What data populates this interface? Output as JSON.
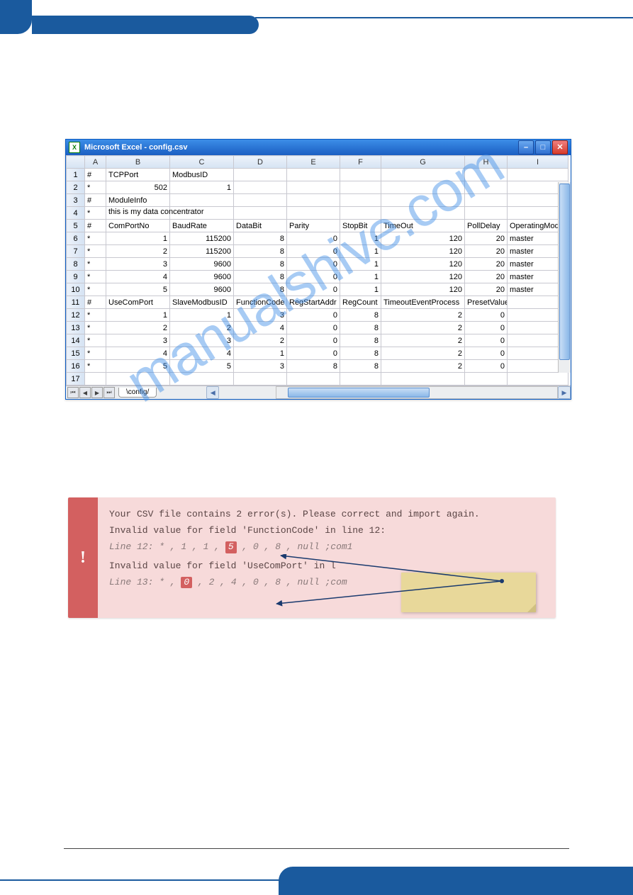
{
  "excel": {
    "title": "Microsoft Excel - config.csv",
    "col_headers": [
      "A",
      "B",
      "C",
      "D",
      "E",
      "F",
      "G",
      "H",
      "I"
    ],
    "rows": [
      {
        "n": "1",
        "A": "#",
        "B": "TCPPort",
        "C": "ModbusID"
      },
      {
        "n": "2",
        "A": "*",
        "B": "502",
        "C": "1",
        "B_num": true,
        "C_num": true
      },
      {
        "n": "3",
        "A": "#",
        "B": "ModuleInfo"
      },
      {
        "n": "4",
        "A": "*",
        "B": "this is my data concentrator",
        "span": true
      },
      {
        "n": "5",
        "A": "#",
        "B": "ComPortNo",
        "C": "BaudRate",
        "D": "DataBit",
        "E": "Parity",
        "F": "StopBit",
        "G": "TimeOut",
        "H": "PollDelay",
        "I": "OperatingMode"
      },
      {
        "n": "6",
        "A": "*",
        "B": "1",
        "C": "115200",
        "D": "8",
        "E": "0",
        "F": "1",
        "G": "120",
        "H": "20",
        "I": "master",
        "nums": [
          "B",
          "C",
          "D",
          "E",
          "F",
          "G",
          "H"
        ]
      },
      {
        "n": "7",
        "A": "*",
        "B": "2",
        "C": "115200",
        "D": "8",
        "E": "0",
        "F": "1",
        "G": "120",
        "H": "20",
        "I": "master",
        "nums": [
          "B",
          "C",
          "D",
          "E",
          "F",
          "G",
          "H"
        ]
      },
      {
        "n": "8",
        "A": "*",
        "B": "3",
        "C": "9600",
        "D": "8",
        "E": "0",
        "F": "1",
        "G": "120",
        "H": "20",
        "I": "master",
        "nums": [
          "B",
          "C",
          "D",
          "E",
          "F",
          "G",
          "H"
        ]
      },
      {
        "n": "9",
        "A": "*",
        "B": "4",
        "C": "9600",
        "D": "8",
        "E": "0",
        "F": "1",
        "G": "120",
        "H": "20",
        "I": "master",
        "nums": [
          "B",
          "C",
          "D",
          "E",
          "F",
          "G",
          "H"
        ]
      },
      {
        "n": "10",
        "A": "*",
        "B": "5",
        "C": "9600",
        "D": "8",
        "E": "0",
        "F": "1",
        "G": "120",
        "H": "20",
        "I": "master",
        "nums": [
          "B",
          "C",
          "D",
          "E",
          "F",
          "G",
          "H"
        ]
      },
      {
        "n": "11",
        "A": "#",
        "B": "UseComPort",
        "C": "SlaveModbusID",
        "D": "FunctionCode",
        "E": "RegStartAddr",
        "F": "RegCount",
        "G": "TimeoutEventProcess",
        "H": "PresetValue"
      },
      {
        "n": "12",
        "A": "*",
        "B": "1",
        "C": "1",
        "D": "3",
        "E": "0",
        "F": "8",
        "G": "2",
        "H": "0",
        "nums": [
          "B",
          "C",
          "D",
          "E",
          "F",
          "G",
          "H"
        ]
      },
      {
        "n": "13",
        "A": "*",
        "B": "2",
        "C": "2",
        "D": "4",
        "E": "0",
        "F": "8",
        "G": "2",
        "H": "0",
        "nums": [
          "B",
          "C",
          "D",
          "E",
          "F",
          "G",
          "H"
        ]
      },
      {
        "n": "14",
        "A": "*",
        "B": "3",
        "C": "3",
        "D": "2",
        "E": "0",
        "F": "8",
        "G": "2",
        "H": "0",
        "nums": [
          "B",
          "C",
          "D",
          "E",
          "F",
          "G",
          "H"
        ]
      },
      {
        "n": "15",
        "A": "*",
        "B": "4",
        "C": "4",
        "D": "1",
        "E": "0",
        "F": "8",
        "G": "2",
        "H": "0",
        "nums": [
          "B",
          "C",
          "D",
          "E",
          "F",
          "G",
          "H"
        ]
      },
      {
        "n": "16",
        "A": "*",
        "B": "5",
        "C": "5",
        "D": "3",
        "E": "8",
        "F": "8",
        "G": "2",
        "H": "0",
        "nums": [
          "B",
          "C",
          "D",
          "E",
          "F",
          "G",
          "H"
        ]
      },
      {
        "n": "17"
      }
    ],
    "sheet_name": "config"
  },
  "error": {
    "bang": "!",
    "heading": "Your CSV file contains 2 error(s). Please correct and import again.",
    "err1_title": "Invalid value for field 'FunctionCode' in line 12:",
    "err1_line_prefix": "Line 12:   * , 1 , 1 , ",
    "err1_hl": "5",
    "err1_line_suffix": " , 0 , 8 , null  ;com1",
    "err2_title": "Invalid value for field 'UseComPort' in l",
    "err2_line_prefix": "Line 13:   * , ",
    "err2_hl": "0",
    "err2_line_suffix": " , 2 , 4 , 0 , 8 , null  ;com"
  },
  "watermark": "manualshive.com"
}
